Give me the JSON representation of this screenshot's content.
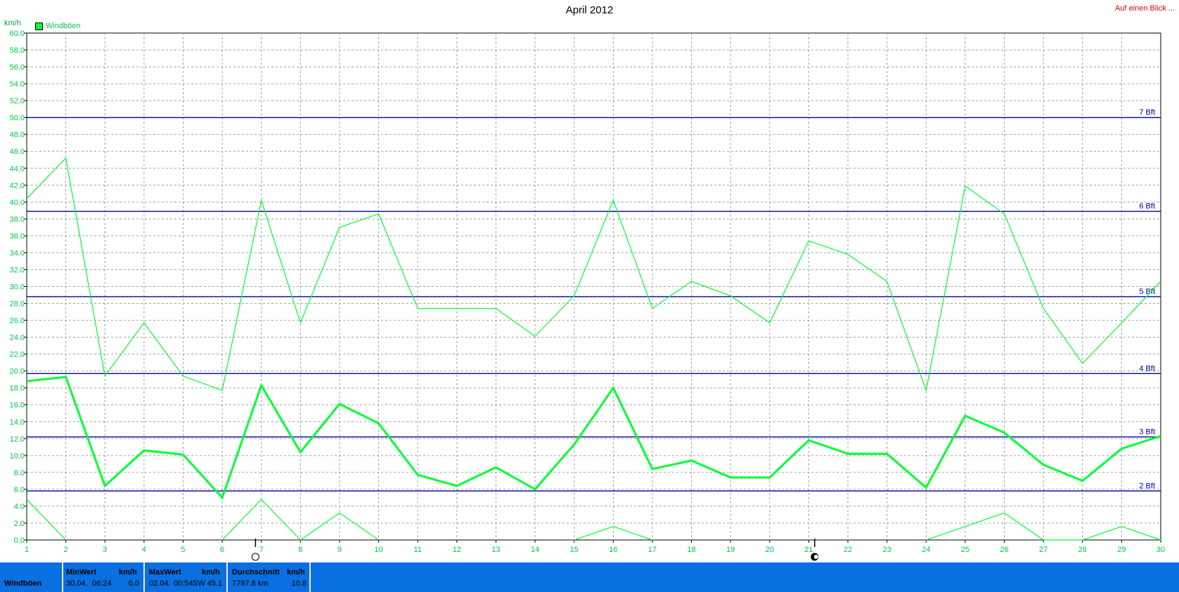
{
  "header": {
    "title": "April 2012",
    "link_label": "Auf einen Blick ...",
    "unit": "km/h",
    "legend_label": "Windböen"
  },
  "colors": {
    "series": "#00ff33",
    "beaufort_lines": "#00009a",
    "grid": "#a0a0a0",
    "axis_text": "#00c84a",
    "footer_bg": "#0a6fe0"
  },
  "chart_data": {
    "type": "line",
    "title": "April 2012",
    "ylabel": "km/h",
    "ylim": [
      0,
      60
    ],
    "xlim": [
      1,
      30
    ],
    "y_tick_step": 2,
    "x": [
      1,
      2,
      3,
      4,
      5,
      6,
      7,
      8,
      9,
      10,
      11,
      12,
      13,
      14,
      15,
      16,
      17,
      18,
      19,
      20,
      21,
      22,
      23,
      24,
      25,
      26,
      27,
      28,
      29,
      30
    ],
    "grid": true,
    "legend_position": "top-left",
    "series": [
      {
        "name": "Windböen",
        "role": "max",
        "values": [
          40.4,
          45.2,
          19.4,
          25.7,
          19.4,
          17.7,
          40.2,
          25.7,
          37.0,
          38.6,
          27.4,
          27.4,
          27.4,
          24.1,
          28.9,
          40.2,
          27.4,
          30.6,
          28.9,
          25.7,
          35.4,
          33.8,
          30.6,
          17.7,
          41.9,
          38.6,
          27.4,
          20.9,
          25.7,
          30.6
        ]
      },
      {
        "role": "average",
        "values": [
          18.8,
          19.3,
          6.4,
          10.6,
          10.1,
          5.0,
          18.3,
          10.4,
          16.1,
          13.8,
          7.7,
          6.4,
          8.6,
          6.0,
          11.3,
          18.0,
          8.4,
          9.4,
          7.4,
          7.4,
          11.8,
          10.2,
          10.2,
          6.2,
          14.7,
          12.7,
          8.9,
          7.0,
          10.8,
          12.3
        ]
      },
      {
        "role": "min",
        "values": [
          4.8,
          0.0,
          null,
          null,
          null,
          0.0,
          4.8,
          0.0,
          3.2,
          0.0,
          null,
          null,
          null,
          null,
          0.0,
          1.6,
          0.0,
          null,
          null,
          null,
          null,
          null,
          null,
          0.0,
          1.6,
          3.2,
          0.0,
          0.0,
          1.6,
          0.0
        ]
      }
    ],
    "reference_lines": [
      {
        "label": "2 Bft",
        "value": 5.8
      },
      {
        "label": "3 Bft",
        "value": 12.2
      },
      {
        "label": "4 Bft",
        "value": 19.7
      },
      {
        "label": "5 Bft",
        "value": 28.8
      },
      {
        "label": "6 Bft",
        "value": 38.9
      },
      {
        "label": "7 Bft",
        "value": 50.0
      }
    ],
    "moon_markers": [
      {
        "phase": "full-moon",
        "x": 6.85
      },
      {
        "phase": "new-moon",
        "x": 21.15
      }
    ]
  },
  "footer": {
    "row_label": "Windböen",
    "min": {
      "label": "MinWert",
      "unit": "km/h",
      "date": "30.04.",
      "time": "06:24",
      "value": "0.0"
    },
    "max": {
      "label": "MaxWert",
      "unit": "km/h",
      "date": "02.04.",
      "time": "00:54",
      "dir": "SW",
      "value": "45.1"
    },
    "avg": {
      "label": "Durchschnitt",
      "unit": "km/h",
      "distance": "7797.8 km",
      "value": "10.8"
    }
  }
}
